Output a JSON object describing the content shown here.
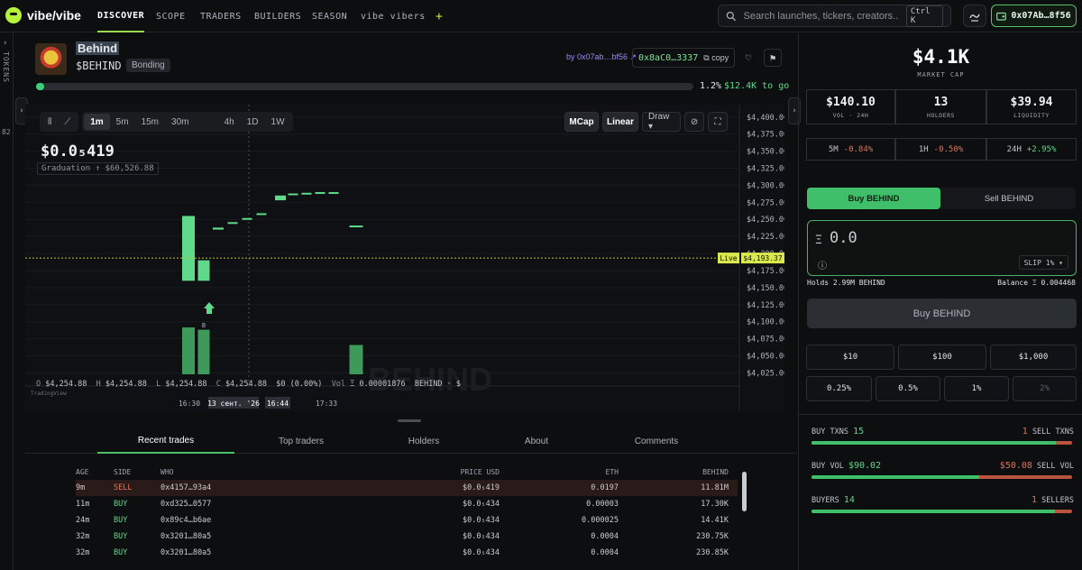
{
  "brand": {
    "name": "vibe/vibe"
  },
  "nav": [
    "DISCOVER",
    "SCOPE",
    "TRADERS",
    "BUILDERS",
    "SEASON",
    "vibe vibers",
    "+"
  ],
  "search": {
    "placeholder": "Search launches, tickers, creators...",
    "shortcut": "Ctrl K"
  },
  "wallet": {
    "address": "0x07Ab…8f56"
  },
  "sidebar": {
    "label": "TOKENS",
    "count": "82"
  },
  "token": {
    "name": "Behind",
    "ticker": "$BEHIND",
    "status": "Bonding",
    "creator": "by 0x07ab…bf56 ↗",
    "contract": "0x8aC0…3337",
    "copy_label": "copy",
    "progress": 0.012,
    "progress_pct": "1.2%",
    "progress_goal": "$12.4K to go"
  },
  "chart_toolbar": {
    "timeframes": [
      "1m",
      "5m",
      "15m",
      "30m",
      "1h",
      "4h",
      "1D",
      "1W"
    ],
    "active_timeframe": "1m",
    "mcap_label": "MCap",
    "scale_label": "Linear",
    "draw_label": "Draw ▾"
  },
  "chart_info": {
    "price": "$0.0₅419",
    "graduation": "Graduation ↑ $60,526.88",
    "ohlc": {
      "o": "$4,254.88",
      "h": "$4,254.88",
      "l": "$4,254.88",
      "c": "$4,254.88",
      "chg": "$0 (0.00%)",
      "vol": "Ξ 0.00001876",
      "pair": "BEHIND · $"
    },
    "attribution": "TradingView",
    "watermark": "BEHIND",
    "marker_label": "B"
  },
  "chart_data": {
    "type": "candlestick",
    "y_ticks": [
      "$4,400.00",
      "$4,375.00",
      "$4,350.00",
      "$4,325.00",
      "$4,300.00",
      "$4,275.00",
      "$4,250.00",
      "$4,225.00",
      "$4,200.00",
      "$4,175.00",
      "$4,150.00",
      "$4,125.00",
      "$4,100.00",
      "$4,075.00",
      "$4,050.00",
      "$4,025.00"
    ],
    "ylim": [
      4015,
      4405
    ],
    "x_ticks": [
      "16:30",
      "13 сент. '26",
      "16:44",
      "17:33"
    ],
    "live_price": 4193.37,
    "live_label": "Live",
    "live_value_label": "$4,193.37",
    "candles": [
      {
        "t": 0,
        "o": 4160,
        "c": 4255,
        "dir": "up",
        "vol": 40
      },
      {
        "t": 1,
        "o": 4160,
        "c": 4190,
        "dir": "up",
        "vol": 38
      },
      {
        "t": 2,
        "o": 4235,
        "c": 4238,
        "dir": "up",
        "vol": 0
      },
      {
        "t": 3,
        "o": 4244,
        "c": 4246,
        "dir": "up",
        "vol": 0
      },
      {
        "t": 4,
        "o": 4250,
        "c": 4252,
        "dir": "up",
        "vol": 0
      },
      {
        "t": 5,
        "o": 4257,
        "c": 4259,
        "dir": "up",
        "vol": 0
      },
      {
        "t": 6,
        "o": 4278,
        "c": 4285,
        "dir": "up",
        "vol": 0
      },
      {
        "t": 7,
        "o": 4286,
        "c": 4288,
        "dir": "up",
        "vol": 0
      },
      {
        "t": 8,
        "o": 4288,
        "c": 4289,
        "dir": "up",
        "vol": 0
      },
      {
        "t": 9,
        "o": 4289,
        "c": 4290,
        "dir": "up",
        "vol": 0
      },
      {
        "t": 10,
        "o": 4289,
        "c": 4290,
        "dir": "up",
        "vol": 0
      },
      {
        "t": 11,
        "o": 4240,
        "c": 4241,
        "dir": "up",
        "vol": 25
      }
    ]
  },
  "tabs": [
    "Recent trades",
    "Top traders",
    "Holders",
    "About",
    "Comments"
  ],
  "trades": {
    "headers": [
      "AGE",
      "SIDE",
      "WHO",
      "PRICE USD",
      "ETH",
      "BEHIND"
    ],
    "rows": [
      [
        "9m",
        "SELL",
        "0x4157…93a4",
        "$0.0₅419",
        "0.0197",
        "11.81M"
      ],
      [
        "11m",
        "BUY",
        "0xd325…0577",
        "$0.0₅434",
        "0.00003",
        "17.30K"
      ],
      [
        "24m",
        "BUY",
        "0x89c4…b6ae",
        "$0.0₅434",
        "0.000025",
        "14.41K"
      ],
      [
        "32m",
        "BUY",
        "0x3201…80a5",
        "$0.0₅434",
        "0.0004",
        "230.75K"
      ],
      [
        "32m",
        "BUY",
        "0x3201…80a5",
        "$0.0₅434",
        "0.0004",
        "230.85K"
      ]
    ]
  },
  "stats": {
    "market_cap": "$4.1K",
    "market_cap_label": "MARKET CAP",
    "vol": "$140.10",
    "vol_label": "VOL · 24H",
    "holders": "13",
    "holders_label": "HOLDERS",
    "liquidity": "$39.94",
    "liquidity_label": "LIQUIDITY",
    "changes": [
      {
        "label": "5M",
        "value": "-0.84%",
        "dir": "neg"
      },
      {
        "label": "1H",
        "value": "-0.50%",
        "dir": "neg"
      },
      {
        "label": "24H",
        "value": "+2.95%",
        "dir": "pos"
      }
    ]
  },
  "trade_panel": {
    "buy_tab": "Buy BEHIND",
    "sell_tab": "Sell BEHIND",
    "currency_symbol": "Ξ",
    "amount": "0.0",
    "slip": "SLIP 1% ▾",
    "holds": "Holds 2.99M BEHIND",
    "balance": "Balance Ξ 0.004468",
    "buy_button": "Buy BEHIND",
    "quick_amounts": [
      "$10",
      "$100",
      "$1,000"
    ],
    "quick_pcts": [
      "0.25%",
      "0.5%",
      "1%",
      "2%"
    ]
  },
  "flow": {
    "buy_txns_label": "BUY TXNS",
    "buy_txns": "15",
    "sell_txns_label": "SELL TXNS",
    "sell_txns": "1",
    "txns_buy_share": 0.938,
    "buy_vol_label": "BUY VOL",
    "buy_vol": "$90.02",
    "sell_vol_label": "SELL VOL",
    "sell_vol": "$50.08",
    "vol_buy_share": 0.643,
    "buyers_label": "BUYERS",
    "buyers": "14",
    "sellers_label": "SELLERS",
    "sellers": "1",
    "buyers_share": 0.933
  }
}
